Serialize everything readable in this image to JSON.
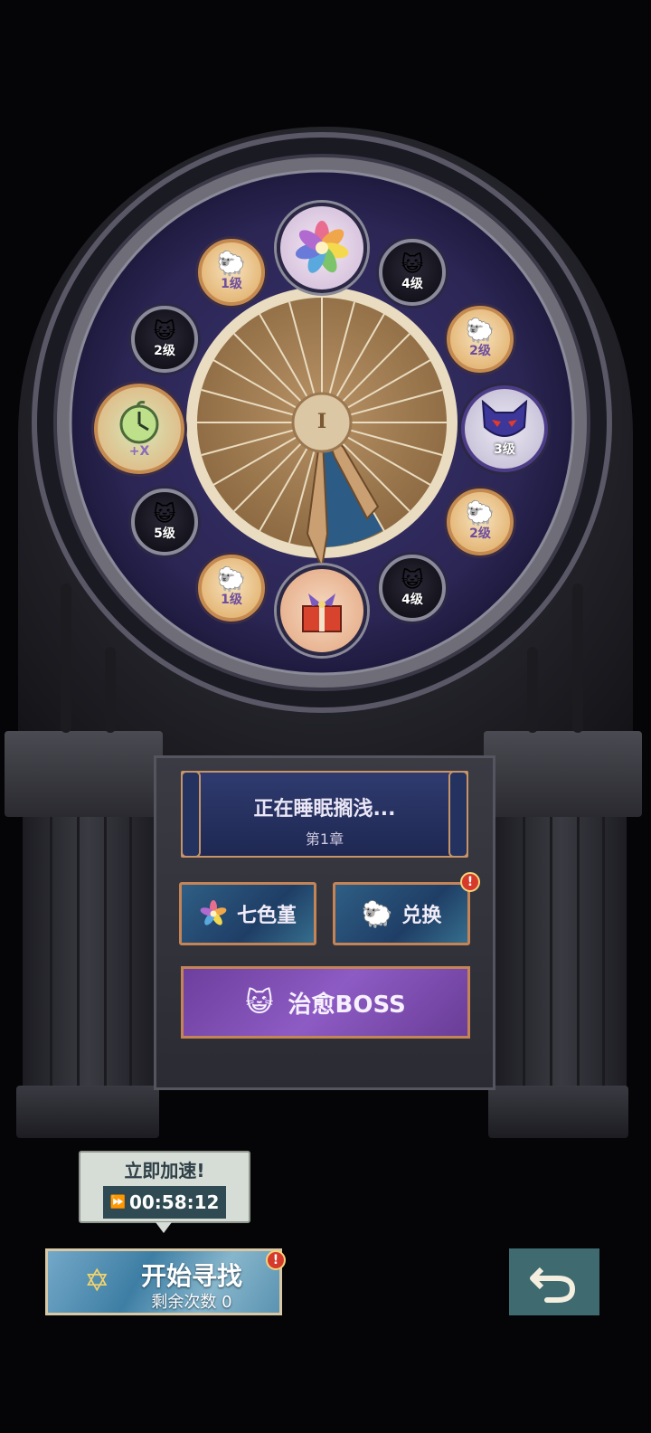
{
  "wheel": {
    "nodes": [
      {
        "id": "top",
        "kind": "flower",
        "label": ""
      },
      {
        "id": "n1",
        "kind": "sheep",
        "level": "1级"
      },
      {
        "id": "n2",
        "kind": "cat",
        "level": "4级"
      },
      {
        "id": "n3",
        "kind": "cat",
        "level": "2级"
      },
      {
        "id": "n4",
        "kind": "sheep",
        "level": "2级"
      },
      {
        "id": "n5",
        "kind": "clock",
        "level": "+X"
      },
      {
        "id": "n6",
        "kind": "boss-cat",
        "level": "3级"
      },
      {
        "id": "n7",
        "kind": "cat",
        "level": "5级"
      },
      {
        "id": "n8",
        "kind": "sheep",
        "level": "2级"
      },
      {
        "id": "n9",
        "kind": "sheep",
        "level": "1级"
      },
      {
        "id": "n10",
        "kind": "cat",
        "level": "4级"
      },
      {
        "id": "bottom",
        "kind": "gift",
        "label": ""
      }
    ],
    "center_numeral": "I",
    "progress_fraction": 0.08
  },
  "panel": {
    "status_title": "正在睡眠搁浅...",
    "chapter": "第1章",
    "flower_button": "七色堇",
    "exchange_button": "兑换",
    "exchange_badge": "!",
    "boss_button": "治愈BOSS"
  },
  "speedup": {
    "title": "立即加速!",
    "timer": "00:58:12"
  },
  "start": {
    "label": "开始寻找",
    "remaining": "剩余次数 0",
    "badge": "!"
  },
  "colors": {
    "dark_purple": "#2b2654",
    "gold": "#c48456",
    "boss_purple": "#8d5bc4",
    "accent_red": "#d63a2b"
  }
}
